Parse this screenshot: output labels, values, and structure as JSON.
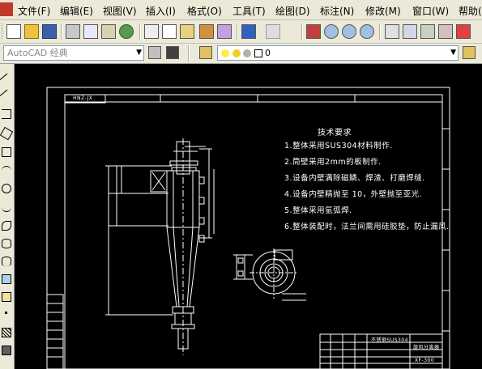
{
  "menubar": {
    "items": [
      "文件(F)",
      "编辑(E)",
      "视图(V)",
      "插入(I)",
      "格式(O)",
      "工具(T)",
      "绘图(D)",
      "标注(N)",
      "修改(M)",
      "窗口(W)",
      "帮助("
    ]
  },
  "workspace": {
    "value": "AutoCAD 经典"
  },
  "layer": {
    "value": "0"
  },
  "drawing": {
    "frame_code": "HNZ-JX",
    "notes_title": "技术要求",
    "notes": [
      "1.整体采用SUS304材料制作.",
      "2.筒壁采用2mm的板制作.",
      "3.设备内壁满除磁鳞、焊渣、打磨焊缝.",
      "4.设备内壁精抛至 10，外壁抛至亚光.",
      "5.整体采用氩弧焊.",
      "6.整体装配时，法兰间需用硅胶垫，防止漏风."
    ],
    "title_block": {
      "material": "不锈钢SUS304",
      "name": "旋风分离器",
      "code": "XF-300"
    }
  },
  "colors": {
    "canvas_bg": "#000000",
    "drawing_lines": "#ffffff",
    "menubar_bg": "#ece9d8"
  }
}
